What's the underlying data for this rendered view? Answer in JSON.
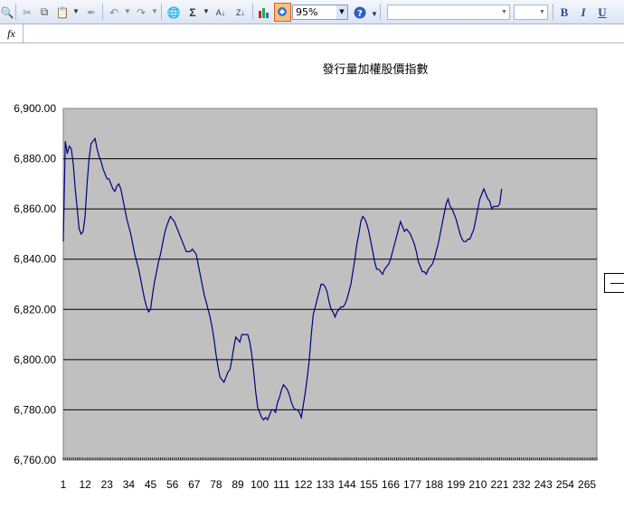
{
  "toolbar": {
    "zoom_value": "95%",
    "bold_label": "B",
    "italic_label": "I",
    "underline_label": "U",
    "sum_label": "Σ",
    "sort_asc_label": "A↓",
    "sort_desc_label": "Z↓",
    "font_name_value": "",
    "font_size_value": ""
  },
  "formula_bar": {
    "fx_label": "fx",
    "content": ""
  },
  "colors": {
    "line": "#000080",
    "plot_bg": "#c0c0c0",
    "grid": "#000000"
  },
  "chart_data": {
    "type": "line",
    "title": "發行量加權股價指數",
    "xlabel": "",
    "ylabel": "",
    "ylim": [
      6760,
      6900
    ],
    "yticks": [
      6760,
      6780,
      6800,
      6820,
      6840,
      6860,
      6880,
      6900
    ],
    "ytick_labels": [
      "6,760.00",
      "6,780.00",
      "6,800.00",
      "6,820.00",
      "6,840.00",
      "6,860.00",
      "6,880.00",
      "6,900.00"
    ],
    "xticks": [
      1,
      12,
      23,
      34,
      45,
      56,
      67,
      78,
      89,
      100,
      111,
      122,
      133,
      144,
      155,
      166,
      177,
      188,
      199,
      210,
      221,
      232,
      243,
      254,
      265
    ],
    "xlim": [
      1,
      270
    ],
    "grid": true,
    "legend_placement": "right",
    "series": [
      {
        "points": [
          [
            1,
            6847
          ],
          [
            2,
            6887
          ],
          [
            3,
            6882
          ],
          [
            4,
            6885
          ],
          [
            5,
            6884
          ],
          [
            6,
            6878
          ],
          [
            7,
            6868
          ],
          [
            8,
            6860
          ],
          [
            9,
            6852
          ],
          [
            10,
            6850
          ],
          [
            11,
            6851
          ],
          [
            12,
            6857
          ],
          [
            13,
            6870
          ],
          [
            14,
            6880
          ],
          [
            15,
            6886
          ],
          [
            16,
            6887
          ],
          [
            17,
            6888
          ],
          [
            18,
            6884
          ],
          [
            19,
            6881
          ],
          [
            20,
            6879
          ],
          [
            21,
            6876
          ],
          [
            22,
            6874
          ],
          [
            23,
            6872
          ],
          [
            24,
            6872
          ],
          [
            25,
            6870
          ],
          [
            26,
            6868
          ],
          [
            27,
            6867
          ],
          [
            28,
            6869
          ],
          [
            29,
            6870
          ],
          [
            30,
            6868
          ],
          [
            31,
            6864
          ],
          [
            32,
            6860
          ],
          [
            33,
            6856
          ],
          [
            34,
            6853
          ],
          [
            35,
            6850
          ],
          [
            36,
            6846
          ],
          [
            37,
            6842
          ],
          [
            38,
            6839
          ],
          [
            39,
            6836
          ],
          [
            40,
            6832
          ],
          [
            41,
            6828
          ],
          [
            42,
            6824
          ],
          [
            43,
            6821
          ],
          [
            44,
            6819
          ],
          [
            45,
            6820
          ],
          [
            46,
            6826
          ],
          [
            47,
            6831
          ],
          [
            48,
            6835
          ],
          [
            49,
            6839
          ],
          [
            50,
            6842
          ],
          [
            51,
            6846
          ],
          [
            52,
            6850
          ],
          [
            53,
            6853
          ],
          [
            54,
            6855
          ],
          [
            55,
            6857
          ],
          [
            56,
            6856
          ],
          [
            57,
            6855
          ],
          [
            58,
            6853
          ],
          [
            59,
            6851
          ],
          [
            60,
            6849
          ],
          [
            61,
            6847
          ],
          [
            62,
            6845
          ],
          [
            63,
            6843
          ],
          [
            64,
            6843
          ],
          [
            65,
            6843
          ],
          [
            66,
            6844
          ],
          [
            67,
            6843
          ],
          [
            68,
            6842
          ],
          [
            69,
            6838
          ],
          [
            70,
            6834
          ],
          [
            71,
            6830
          ],
          [
            72,
            6826
          ],
          [
            73,
            6823
          ],
          [
            74,
            6820
          ],
          [
            75,
            6817
          ],
          [
            76,
            6813
          ],
          [
            77,
            6808
          ],
          [
            78,
            6802
          ],
          [
            79,
            6797
          ],
          [
            80,
            6793
          ],
          [
            81,
            6792
          ],
          [
            82,
            6791
          ],
          [
            83,
            6793
          ],
          [
            84,
            6795
          ],
          [
            85,
            6796
          ],
          [
            86,
            6800
          ],
          [
            87,
            6805
          ],
          [
            88,
            6809
          ],
          [
            89,
            6808
          ],
          [
            90,
            6807
          ],
          [
            91,
            6810
          ],
          [
            92,
            6810
          ],
          [
            93,
            6810
          ],
          [
            94,
            6810
          ],
          [
            95,
            6807
          ],
          [
            96,
            6802
          ],
          [
            97,
            6795
          ],
          [
            98,
            6787
          ],
          [
            99,
            6781
          ],
          [
            100,
            6779
          ],
          [
            101,
            6777
          ],
          [
            102,
            6776
          ],
          [
            103,
            6777
          ],
          [
            104,
            6776
          ],
          [
            105,
            6778
          ],
          [
            106,
            6780
          ],
          [
            107,
            6780
          ],
          [
            108,
            6779
          ],
          [
            109,
            6783
          ],
          [
            110,
            6785
          ],
          [
            111,
            6788
          ],
          [
            112,
            6790
          ],
          [
            113,
            6789
          ],
          [
            114,
            6788
          ],
          [
            115,
            6786
          ],
          [
            116,
            6783
          ],
          [
            117,
            6781
          ],
          [
            118,
            6780
          ],
          [
            119,
            6780
          ],
          [
            120,
            6779
          ],
          [
            121,
            6777
          ],
          [
            122,
            6782
          ],
          [
            123,
            6787
          ],
          [
            124,
            6793
          ],
          [
            125,
            6800
          ],
          [
            126,
            6810
          ],
          [
            127,
            6818
          ],
          [
            128,
            6821
          ],
          [
            129,
            6824
          ],
          [
            130,
            6827
          ],
          [
            131,
            6830
          ],
          [
            132,
            6830
          ],
          [
            133,
            6829
          ],
          [
            134,
            6827
          ],
          [
            135,
            6823
          ],
          [
            136,
            6820
          ],
          [
            137,
            6819
          ],
          [
            138,
            6817
          ],
          [
            139,
            6819
          ],
          [
            140,
            6820
          ],
          [
            141,
            6821
          ],
          [
            142,
            6821
          ],
          [
            143,
            6822
          ],
          [
            144,
            6824
          ],
          [
            145,
            6827
          ],
          [
            146,
            6830
          ],
          [
            147,
            6835
          ],
          [
            148,
            6840
          ],
          [
            149,
            6846
          ],
          [
            150,
            6850
          ],
          [
            151,
            6855
          ],
          [
            152,
            6857
          ],
          [
            153,
            6856
          ],
          [
            154,
            6854
          ],
          [
            155,
            6851
          ],
          [
            156,
            6847
          ],
          [
            157,
            6843
          ],
          [
            158,
            6839
          ],
          [
            159,
            6836
          ],
          [
            160,
            6836
          ],
          [
            161,
            6835
          ],
          [
            162,
            6834
          ],
          [
            163,
            6836
          ],
          [
            164,
            6837
          ],
          [
            165,
            6838
          ],
          [
            166,
            6840
          ],
          [
            167,
            6843
          ],
          [
            168,
            6846
          ],
          [
            169,
            6849
          ],
          [
            170,
            6852
          ],
          [
            171,
            6855
          ],
          [
            172,
            6853
          ],
          [
            173,
            6851
          ],
          [
            174,
            6852
          ],
          [
            175,
            6851
          ],
          [
            176,
            6850
          ],
          [
            177,
            6848
          ],
          [
            178,
            6846
          ],
          [
            179,
            6843
          ],
          [
            180,
            6839
          ],
          [
            181,
            6837
          ],
          [
            182,
            6835
          ],
          [
            183,
            6835
          ],
          [
            184,
            6834
          ],
          [
            185,
            6836
          ],
          [
            186,
            6837
          ],
          [
            187,
            6838
          ],
          [
            188,
            6840
          ],
          [
            189,
            6843
          ],
          [
            190,
            6846
          ],
          [
            191,
            6850
          ],
          [
            192,
            6854
          ],
          [
            193,
            6858
          ],
          [
            194,
            6862
          ],
          [
            195,
            6864
          ],
          [
            196,
            6861
          ],
          [
            197,
            6860
          ],
          [
            198,
            6858
          ],
          [
            199,
            6856
          ],
          [
            200,
            6853
          ],
          [
            201,
            6850
          ],
          [
            202,
            6848
          ],
          [
            203,
            6847
          ],
          [
            204,
            6847
          ],
          [
            205,
            6848
          ],
          [
            206,
            6848
          ],
          [
            207,
            6850
          ],
          [
            208,
            6852
          ],
          [
            209,
            6856
          ],
          [
            210,
            6860
          ],
          [
            211,
            6864
          ],
          [
            212,
            6866
          ],
          [
            213,
            6868
          ],
          [
            214,
            6866
          ],
          [
            215,
            6864
          ],
          [
            216,
            6863
          ],
          [
            217,
            6860
          ],
          [
            218,
            6861
          ],
          [
            219,
            6861
          ],
          [
            220,
            6861
          ],
          [
            221,
            6862
          ],
          [
            222,
            6868
          ]
        ]
      }
    ]
  }
}
